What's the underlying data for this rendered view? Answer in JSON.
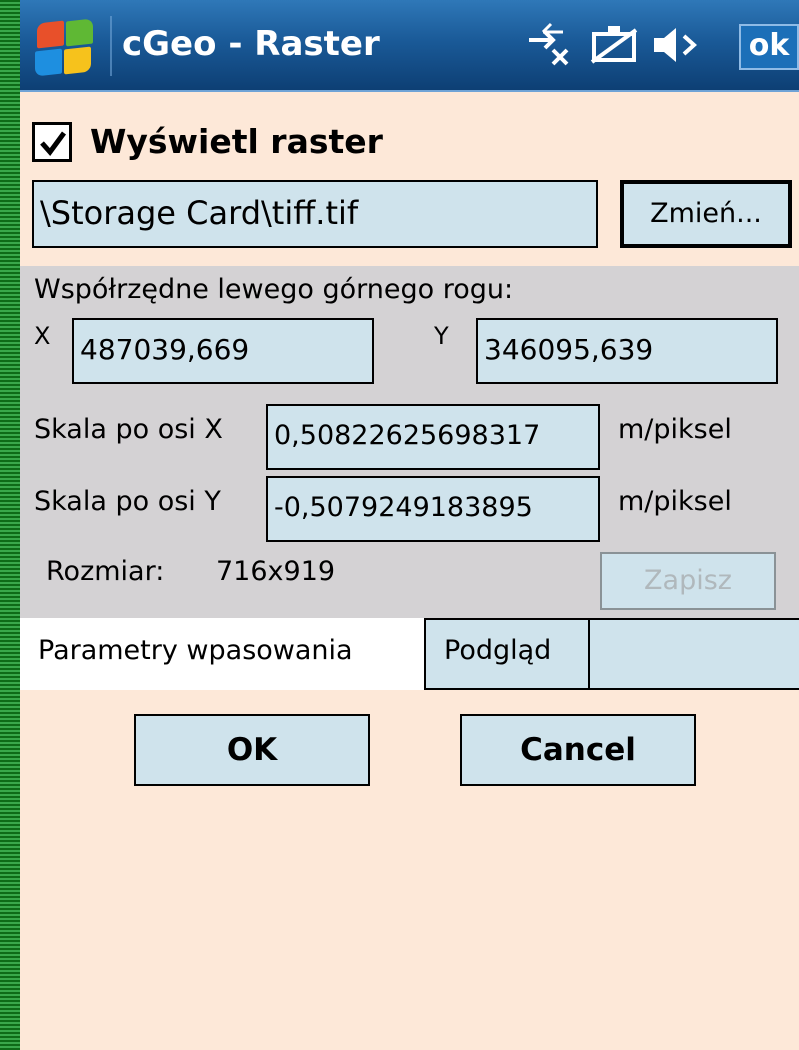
{
  "window": {
    "title": "cGeo - Raster",
    "ok_label": "ok"
  },
  "status_icons": [
    "connectivity-icon",
    "battery-icon",
    "volume-icon"
  ],
  "display_raster": {
    "label": "Wyświetl raster",
    "checked": true
  },
  "file": {
    "path": "\\Storage Card\\tiff.tif",
    "change_label": "Zmień..."
  },
  "corner": {
    "heading": "Współrzędne lewego górnego rogu:",
    "x_label": "X",
    "x_value": "487039,669",
    "y_label": "Y",
    "y_value": "346095,639"
  },
  "scale": {
    "x_label": "Skala po osi X",
    "x_value": "0,50822625698317",
    "x_unit": "m/piksel",
    "y_label": "Skala po osi Y",
    "y_value": "-0,5079249183895",
    "y_unit": "m/piksel"
  },
  "size": {
    "label": "Rozmiar:",
    "value": "716x919"
  },
  "save_label": "Zapisz",
  "tabs": [
    {
      "label": "Parametry wpasowania",
      "active": true
    },
    {
      "label": "Podgląd",
      "active": false
    }
  ],
  "ok_label": "OK",
  "cancel_label": "Cancel",
  "colors": {
    "titlebar": "#1a5a98",
    "background": "#fde8d8",
    "field": "#cfe3ec",
    "panel": "#d4d2d4",
    "disabled_text": "#b0b8bc"
  }
}
